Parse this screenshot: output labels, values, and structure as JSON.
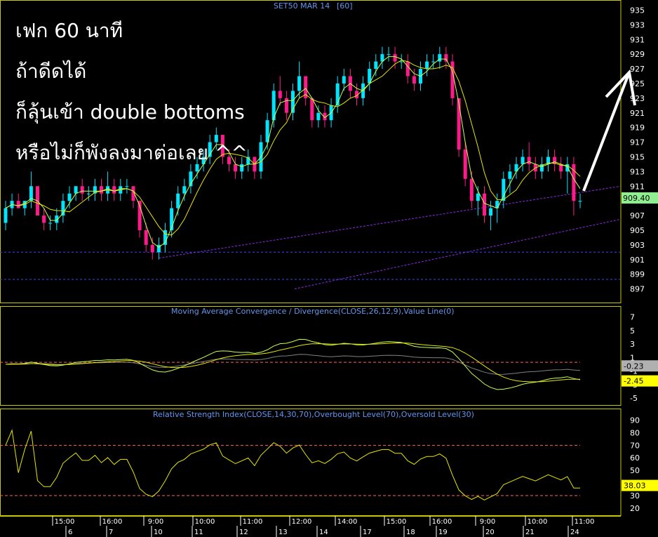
{
  "annotations": {
    "line1": "เฟก 60 นาที",
    "line2": "ถ้าดีดได้",
    "line3": "ก็ลุ้นเข้า double bottoms",
    "line4": "หรือไม่ก็พังลงมาต่อเลย ^^"
  },
  "colors": {
    "background": "#000000",
    "grid": "#ffffff",
    "frame": "#c8c800",
    "price_axis_text": "#ffffff",
    "title_text": "#6495ed",
    "candle_up": "#00e5ff",
    "candle_down": "#ff1a8c",
    "ma_fast": "#c8ff50",
    "ma_slow": "#e6e600",
    "trend": "#8a2be2",
    "level": "#4040ff",
    "macd": "#c8ff50",
    "signal": "#e6e600",
    "macd_hist_line": "#808080",
    "rsi": "#e6e600",
    "rsi_levels": "#ff6060",
    "last_price_bg": "#90ee90",
    "macd_label_bg": "#ffff00",
    "rsi_label_bg": "#ffff00"
  },
  "chart_data": {
    "type": "candlestick",
    "title": "SET50 MAR 14",
    "interval_label": "[60]",
    "price_axis": {
      "ticks": [
        "935",
        "933",
        "931",
        "929",
        "927",
        "925",
        "923",
        "921",
        "919",
        "917",
        "915",
        "913",
        "911",
        "909",
        "907",
        "905",
        "903",
        "901",
        "899",
        "897"
      ],
      "min": 896,
      "max": 936
    },
    "last_price": "909.40",
    "time_axis": {
      "time_labels": [
        "15:00",
        "16:00",
        "9:00",
        "10:00",
        "11:00",
        "12:00",
        "14:00",
        "15:00",
        "16:00",
        "9:00",
        "10:00",
        "11:00"
      ],
      "day_labels": [
        "6",
        "7",
        "10",
        "11",
        "12",
        "13",
        "14",
        "17",
        "18",
        "19",
        "20",
        "21",
        "24"
      ]
    },
    "candles": [
      [
        906,
        909,
        905,
        908
      ],
      [
        908,
        910,
        907,
        909
      ],
      [
        909,
        910,
        908,
        908
      ],
      [
        908,
        909,
        907,
        909
      ],
      [
        909,
        913,
        908,
        911
      ],
      [
        911,
        911,
        907,
        907
      ],
      [
        907,
        908,
        905,
        906
      ],
      [
        906,
        907,
        905,
        906
      ],
      [
        906,
        908,
        905,
        907
      ],
      [
        907,
        910,
        906,
        909
      ],
      [
        909,
        911,
        908,
        910
      ],
      [
        910,
        911,
        909,
        911
      ],
      [
        911,
        912,
        909,
        910
      ],
      [
        910,
        911,
        909,
        910
      ],
      [
        910,
        912,
        909,
        911
      ],
      [
        911,
        912,
        909,
        910
      ],
      [
        910,
        913,
        909,
        911
      ],
      [
        911,
        912,
        909,
        910
      ],
      [
        910,
        912,
        909,
        911
      ],
      [
        911,
        912,
        910,
        911
      ],
      [
        911,
        911,
        908,
        909
      ],
      [
        909,
        909,
        904,
        905
      ],
      [
        905,
        906,
        902,
        903
      ],
      [
        903,
        904,
        901,
        902
      ],
      [
        902,
        904,
        901,
        903
      ],
      [
        903,
        906,
        902,
        905
      ],
      [
        905,
        909,
        904,
        908
      ],
      [
        908,
        911,
        907,
        910
      ],
      [
        910,
        912,
        909,
        911
      ],
      [
        911,
        914,
        910,
        913
      ],
      [
        913,
        915,
        912,
        914
      ],
      [
        914,
        916,
        913,
        915
      ],
      [
        915,
        918,
        914,
        917
      ],
      [
        917,
        919,
        916,
        918
      ],
      [
        918,
        918,
        914,
        915
      ],
      [
        915,
        916,
        913,
        914
      ],
      [
        914,
        915,
        912,
        913
      ],
      [
        913,
        915,
        912,
        914
      ],
      [
        914,
        916,
        913,
        915
      ],
      [
        915,
        915,
        912,
        913
      ],
      [
        913,
        918,
        912,
        917
      ],
      [
        917,
        921,
        916,
        920
      ],
      [
        920,
        925,
        919,
        924
      ],
      [
        924,
        926,
        922,
        923
      ],
      [
        923,
        924,
        920,
        921
      ],
      [
        921,
        925,
        920,
        924
      ],
      [
        924,
        928,
        923,
        926
      ],
      [
        926,
        926,
        922,
        923
      ],
      [
        923,
        923,
        919,
        920
      ],
      [
        920,
        922,
        919,
        921
      ],
      [
        921,
        922,
        919,
        920
      ],
      [
        920,
        923,
        919,
        922
      ],
      [
        922,
        926,
        921,
        925
      ],
      [
        925,
        927,
        924,
        926
      ],
      [
        926,
        927,
        923,
        924
      ],
      [
        924,
        925,
        922,
        923
      ],
      [
        923,
        926,
        922,
        925
      ],
      [
        925,
        928,
        924,
        927
      ],
      [
        927,
        929,
        926,
        928
      ],
      [
        928,
        930,
        927,
        929
      ],
      [
        929,
        930,
        928,
        929
      ],
      [
        929,
        930,
        927,
        928
      ],
      [
        928,
        929,
        927,
        928
      ],
      [
        928,
        929,
        925,
        926
      ],
      [
        926,
        927,
        924,
        925
      ],
      [
        925,
        928,
        924,
        927
      ],
      [
        927,
        929,
        926,
        928
      ],
      [
        928,
        929,
        927,
        928
      ],
      [
        928,
        930,
        927,
        929
      ],
      [
        929,
        930,
        927,
        928
      ],
      [
        928,
        929,
        922,
        923
      ],
      [
        923,
        923,
        915,
        916
      ],
      [
        916,
        917,
        911,
        912
      ],
      [
        912,
        913,
        908,
        909
      ],
      [
        909,
        911,
        907,
        910
      ],
      [
        910,
        911,
        906,
        907
      ],
      [
        907,
        909,
        905,
        908
      ],
      [
        908,
        910,
        906,
        909
      ],
      [
        909,
        913,
        908,
        912
      ],
      [
        912,
        914,
        910,
        913
      ],
      [
        913,
        915,
        912,
        914
      ],
      [
        914,
        916,
        913,
        915
      ],
      [
        915,
        917,
        913,
        914
      ],
      [
        914,
        915,
        912,
        913
      ],
      [
        913,
        915,
        912,
        914
      ],
      [
        914,
        916,
        913,
        915
      ],
      [
        915,
        916,
        913,
        914
      ],
      [
        914,
        915,
        912,
        913
      ],
      [
        913,
        915,
        910,
        914
      ],
      [
        914,
        915,
        907,
        909
      ],
      [
        909,
        910,
        908,
        909
      ]
    ],
    "levels": [
      902,
      898.3
    ],
    "indicators": {
      "macd": {
        "title": "Moving Average Convergence / Divergence(CLOSE,26,12,9),Value Line(0)",
        "ticks": [
          "7",
          "5",
          "3",
          "1",
          "-1",
          "-3",
          "-5"
        ],
        "min": -5.5,
        "max": 8,
        "macd_label": "-2.45",
        "signal_label": "-0.23",
        "zero_dashed": true
      },
      "rsi": {
        "title": "Relative Strength Index(CLOSE,14,30,70),Overbought Level(70),Oversold Level(30)",
        "ticks": [
          "90",
          "80",
          "70",
          "60",
          "50",
          "40",
          "30",
          "20"
        ],
        "min": 16,
        "max": 97,
        "overbought": 70,
        "oversold": 30,
        "last_label": "38.03"
      }
    }
  }
}
